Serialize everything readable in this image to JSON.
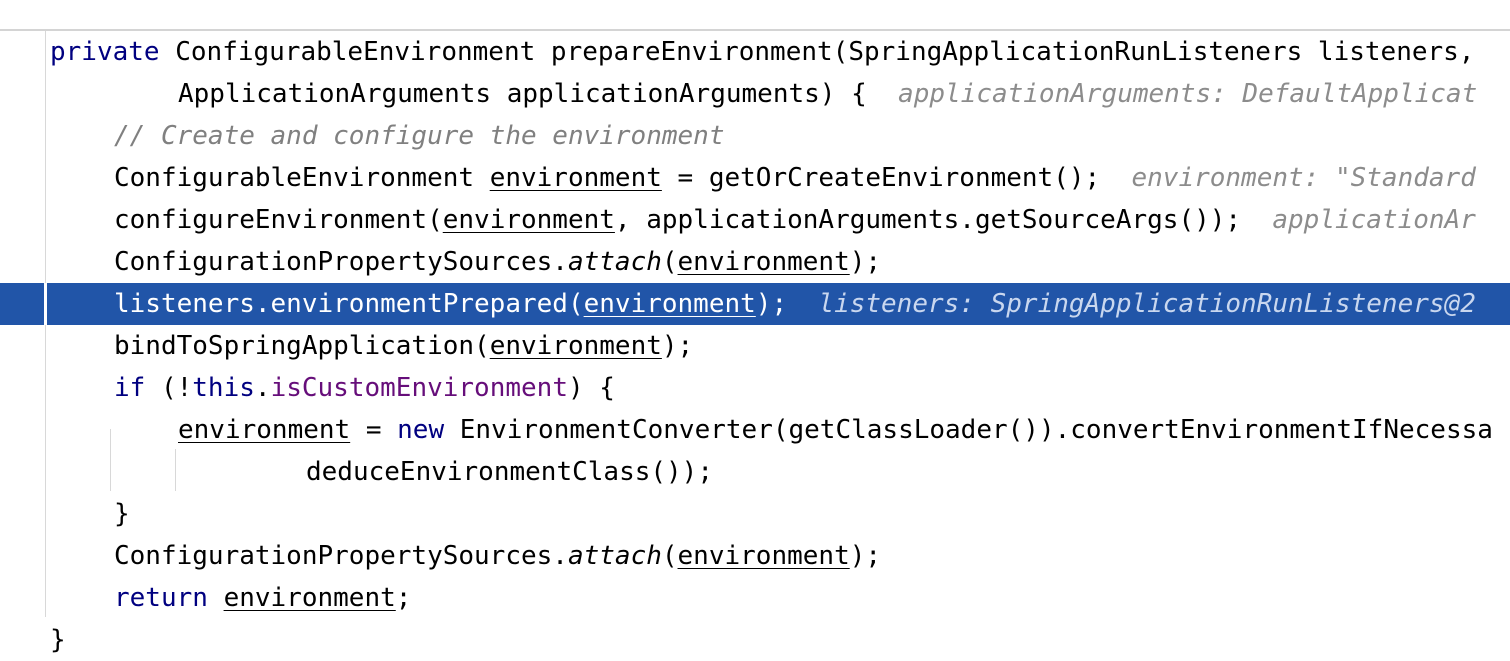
{
  "editor": {
    "lines": [
      {
        "tokens": [
          {
            "t": "private",
            "c": "kw"
          },
          {
            "t": " ConfigurableEnvironment prepareEnvironment(SpringApplicationRunListeners listeners,"
          }
        ]
      },
      {
        "tokens": [
          {
            "t": "ApplicationArguments applicationArguments) {"
          },
          {
            "t": "  applicationArguments: DefaultApplicat",
            "c": "hint"
          }
        ]
      },
      {
        "tokens": [
          {
            "t": "// Create and configure the environment",
            "c": "cm"
          }
        ]
      },
      {
        "tokens": [
          {
            "t": "ConfigurableEnvironment "
          },
          {
            "t": "environment",
            "c": "u"
          },
          {
            "t": " = getOrCreateEnvironment();"
          },
          {
            "t": "  environment: \"Standard",
            "c": "hint"
          }
        ]
      },
      {
        "tokens": [
          {
            "t": "configureEnvironment("
          },
          {
            "t": "environment",
            "c": "u"
          },
          {
            "t": ", applicationArguments.getSourceArgs());"
          },
          {
            "t": "  applicationAr",
            "c": "hint"
          }
        ]
      },
      {
        "tokens": [
          {
            "t": "ConfigurationPropertySources."
          },
          {
            "t": "attach",
            "c": "st"
          },
          {
            "t": "("
          },
          {
            "t": "environment",
            "c": "u"
          },
          {
            "t": ");"
          }
        ]
      },
      {
        "current": true,
        "tokens": [
          {
            "t": "listeners.environmentPrepared("
          },
          {
            "t": "environment",
            "c": "u"
          },
          {
            "t": ");"
          },
          {
            "t": "  listeners: SpringApplicationRunListeners@2",
            "c": "hint"
          }
        ]
      },
      {
        "tokens": [
          {
            "t": "bindToSpringApplication("
          },
          {
            "t": "environment",
            "c": "u"
          },
          {
            "t": ");"
          }
        ]
      },
      {
        "tokens": [
          {
            "t": "if",
            "c": "kw"
          },
          {
            "t": " (!"
          },
          {
            "t": "this",
            "c": "kw"
          },
          {
            "t": "."
          },
          {
            "t": "isCustomEnvironment",
            "c": "field"
          },
          {
            "t": ") {"
          }
        ]
      },
      {
        "tokens": [
          {
            "t": "environment",
            "c": "u"
          },
          {
            "t": " = "
          },
          {
            "t": "new",
            "c": "kw"
          },
          {
            "t": " EnvironmentConverter(getClassLoader()).convertEnvironmentIfNecessa"
          }
        ]
      },
      {
        "tokens": [
          {
            "t": "deduceEnvironmentClass());"
          }
        ]
      },
      {
        "tokens": [
          {
            "t": "}"
          }
        ]
      },
      {
        "tokens": [
          {
            "t": "ConfigurationPropertySources."
          },
          {
            "t": "attach",
            "c": "st"
          },
          {
            "t": "("
          },
          {
            "t": "environment",
            "c": "u"
          },
          {
            "t": ");"
          }
        ]
      },
      {
        "tokens": [
          {
            "t": "return",
            "c": "kw"
          },
          {
            "t": " "
          },
          {
            "t": "environment",
            "c": "u"
          },
          {
            "t": ";"
          }
        ]
      },
      {
        "tokens": [
          {
            "t": "}"
          }
        ]
      }
    ]
  }
}
